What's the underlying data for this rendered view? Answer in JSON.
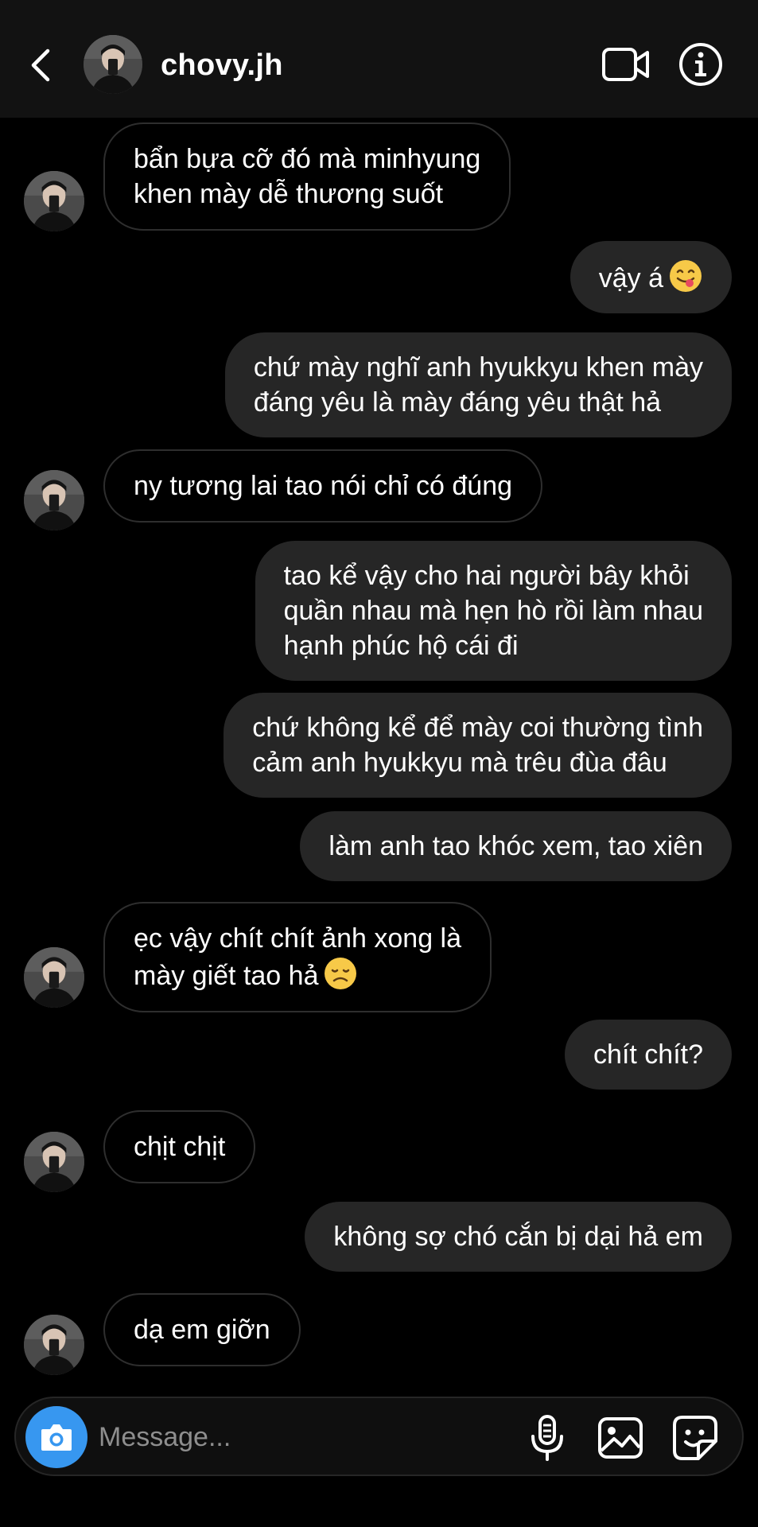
{
  "header": {
    "username": "chovy.jh",
    "icons": [
      "chevron-left-icon",
      "video-camera-icon",
      "info-icon"
    ]
  },
  "messages": [
    {
      "side": "in",
      "text": "bẩn bựa cỡ đó mà minhyung\nkhen mày dễ thương suốt"
    },
    {
      "side": "out",
      "text": "vậy á",
      "emoji": "yum"
    },
    {
      "side": "out",
      "text": "chứ mày nghĩ anh hyukkyu khen mày\nđáng yêu là mày đáng yêu thật hả"
    },
    {
      "side": "in",
      "text": "ny tương lai tao nói chỉ có đúng"
    },
    {
      "side": "out",
      "text": "tao kể vậy cho hai người bây khỏi\nquần nhau mà hẹn hò rồi làm nhau\nhạnh phúc hộ cái đi"
    },
    {
      "side": "out",
      "text": "chứ không kể để mày coi thường tình\ncảm anh hyukkyu mà trêu đùa đâu"
    },
    {
      "side": "out",
      "text": "làm anh tao khóc xem, tao xiên"
    },
    {
      "side": "in",
      "text": "ẹc vậy chít chít ảnh xong là\nmày giết tao hả",
      "emoji": "disappointed"
    },
    {
      "side": "out",
      "text": "chít chít?"
    },
    {
      "side": "in",
      "text": "chịt chịt"
    },
    {
      "side": "out",
      "text": "không sợ chó cắn bị dại hả em"
    },
    {
      "side": "in",
      "text": "dạ em giỡn"
    }
  ],
  "composer": {
    "placeholder": "Message...",
    "icons": [
      "camera-icon",
      "microphone-icon",
      "gallery-icon",
      "sticker-icon"
    ]
  },
  "colors": {
    "header_bg": "#121212",
    "outgoing_bubble": "#262626",
    "incoming_border": "#2e2e2e",
    "camera_button": "#3797f0",
    "placeholder": "#8e8e8e"
  }
}
